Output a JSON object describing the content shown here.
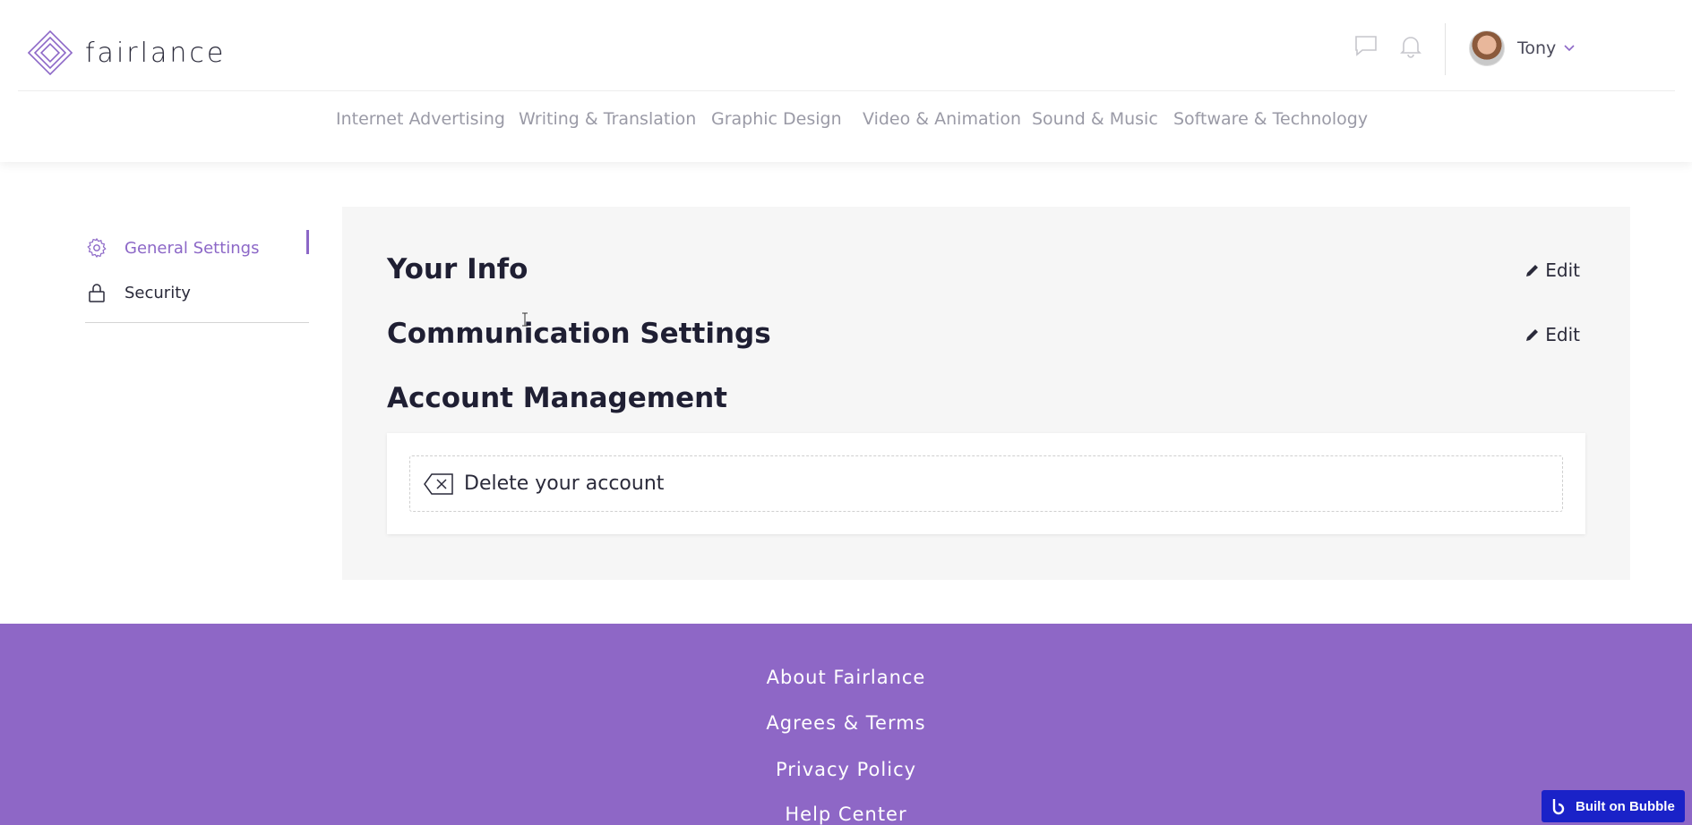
{
  "header": {
    "logo_text": "fairlance",
    "icons": [
      "chat-icon",
      "bell-icon"
    ],
    "user": {
      "name": "Tony"
    }
  },
  "nav": {
    "items": [
      "Internet Advertising",
      "Writing & Translation",
      "Graphic Design",
      "Video & Animation",
      "Sound & Music",
      "Software & Technology"
    ]
  },
  "sidebar": {
    "items": [
      {
        "label": "General Settings",
        "icon": "gear-icon",
        "active": true
      },
      {
        "label": "Security",
        "icon": "lock-icon",
        "active": false
      }
    ]
  },
  "main": {
    "your_info": {
      "title_light": "Your ",
      "title_bold": "Info",
      "edit": "Edit"
    },
    "communication": {
      "title_light": "Communication ",
      "title_bold": "Settings",
      "edit": "Edit"
    },
    "account": {
      "title_light": "Account ",
      "title_bold": "Management",
      "delete_label": "Delete your account"
    }
  },
  "footer": {
    "links": [
      "About Fairlance",
      "Agrees & Terms",
      "Privacy Policy",
      "Help Center"
    ]
  },
  "badge": {
    "label": "Built on Bubble"
  },
  "colors": {
    "accent": "#8c67c7",
    "footer_bg": "#8e67c6",
    "panel_bg": "#f6f6f6",
    "bubble_bg": "#1a22c8"
  }
}
